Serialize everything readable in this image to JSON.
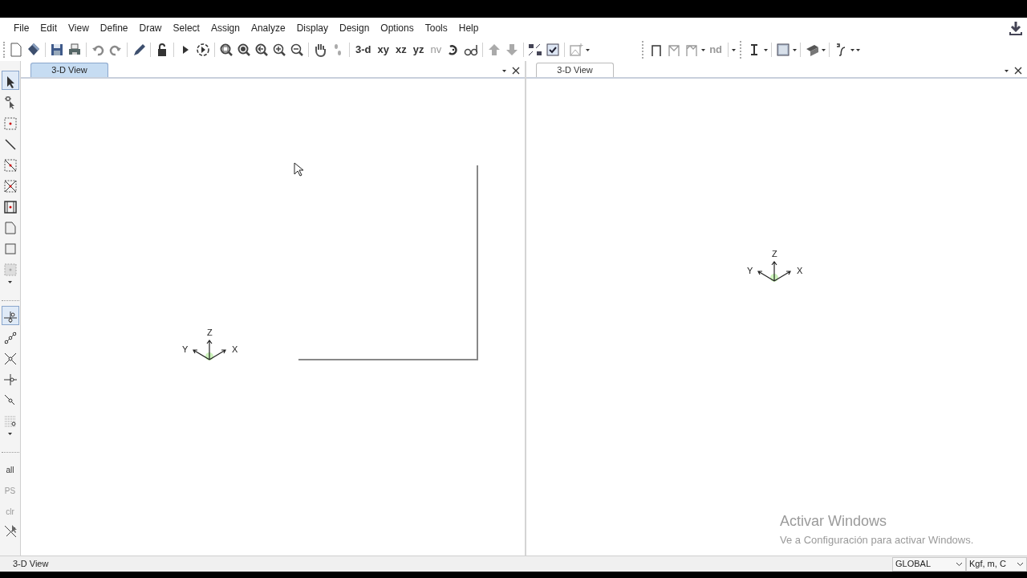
{
  "menu": [
    "File",
    "Edit",
    "View",
    "Define",
    "Draw",
    "Select",
    "Assign",
    "Analyze",
    "Display",
    "Design",
    "Options",
    "Tools",
    "Help"
  ],
  "toolbar": {
    "view_buttons": [
      {
        "label": "3-d",
        "disabled": false
      },
      {
        "label": "xy",
        "disabled": false
      },
      {
        "label": "xz",
        "disabled": false
      },
      {
        "label": "yz",
        "disabled": false
      },
      {
        "label": "nv",
        "disabled": true
      }
    ],
    "design_buttons": [
      {
        "label": "nd",
        "disabled": true
      }
    ]
  },
  "left_toolbar": [
    {
      "kind": "icon",
      "selected": true
    },
    {
      "kind": "icon",
      "selected": false
    },
    {
      "kind": "icon",
      "selected": false
    },
    {
      "kind": "icon",
      "selected": false
    },
    {
      "kind": "icon",
      "selected": false
    },
    {
      "kind": "icon",
      "selected": false
    },
    {
      "kind": "icon",
      "selected": false
    },
    {
      "kind": "icon",
      "selected": false
    },
    {
      "kind": "icon",
      "selected": false
    },
    {
      "kind": "icon",
      "selected": false
    },
    {
      "kind": "icon",
      "selected": true
    },
    {
      "kind": "icon",
      "selected": false
    },
    {
      "kind": "icon",
      "selected": false
    },
    {
      "kind": "icon",
      "selected": false
    },
    {
      "kind": "icon",
      "selected": false
    },
    {
      "kind": "icon",
      "selected": false
    },
    {
      "kind": "text",
      "label": "all",
      "selected": false
    },
    {
      "kind": "text",
      "label": "PS",
      "selected": false
    },
    {
      "kind": "text",
      "label": "clr",
      "selected": false
    },
    {
      "kind": "icon",
      "selected": false
    }
  ],
  "panes": [
    {
      "tab": {
        "label": "3-D View",
        "selected": true
      },
      "axes": {
        "z": "Z",
        "y": "Y",
        "x": "X"
      },
      "has_frame": true
    },
    {
      "tab": {
        "label": "3-D View",
        "selected": false
      },
      "axes": {
        "z": "Z",
        "y": "Y",
        "x": "X"
      }
    }
  ],
  "watermark_notice": {
    "title": "Activar Windows",
    "subtitle": "Ve a Configuración para activar Windows."
  },
  "status_bar": {
    "text": "3-D View",
    "coordinate_system": "GLOBAL",
    "units": "Kgf, m, C"
  }
}
